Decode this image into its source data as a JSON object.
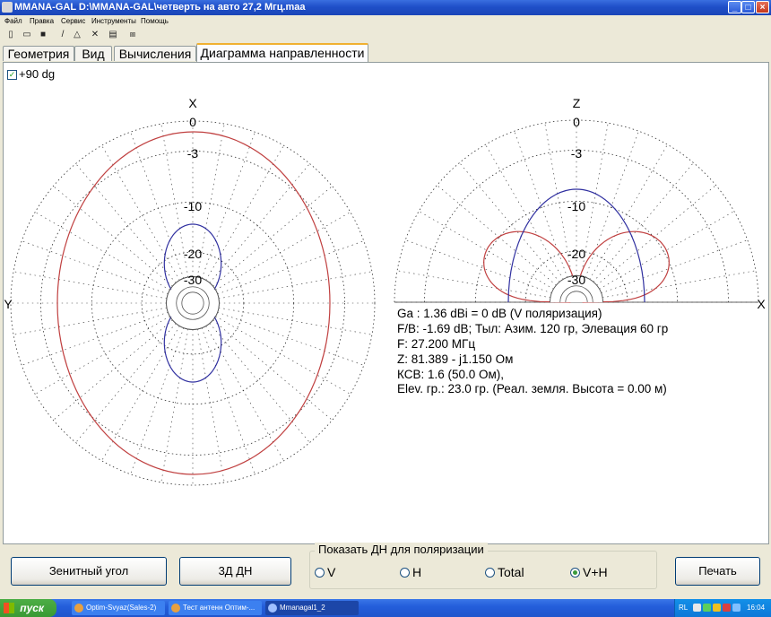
{
  "window": {
    "title": "MMANA-GAL D:\\MMANA-GAL\\четверть на авто 27,2 Мгц.maa"
  },
  "menu": [
    "Файл",
    "Правка",
    "Сервис",
    "Инструменты",
    "Помощь"
  ],
  "toolbar_icons": [
    "new-file-icon",
    "open-folder-icon",
    "save-icon",
    "line-icon",
    "triangle-icon",
    "tools-icon",
    "calculator-icon",
    "antenna-icon"
  ],
  "tabs": [
    "Геометрия",
    "Вид",
    "Вычисления",
    "Диаграмма направленности"
  ],
  "active_tab": "Диаграмма направленности",
  "checkbox": {
    "label": "+90 dg",
    "checked": true
  },
  "plots": {
    "ring_labels": [
      "0",
      "-3",
      "-10",
      "-20",
      "-30"
    ],
    "horizontal": {
      "top_axis": "X",
      "left_axis": "Y"
    },
    "vertical": {
      "top_axis": "Z",
      "right_axis": "X"
    }
  },
  "info": {
    "ga": "Ga : 1.36 dBi = 0 dB  (V поляризация)",
    "fb": "F/B: -1.69 dB; Тыл: Азим. 120 гр, Элевация 60 гр",
    "freq": "F: 27.200 МГц",
    "z": "Z: 81.389 - j1.150 Ом",
    "swr": "КСВ: 1.6 (50.0 Ом),",
    "elev": "Elev. гр.: 23.0 гр. (Реал. земля. Высота = 0.00 м)"
  },
  "buttons": {
    "zenith": "Зенитный угол",
    "three_d": "3Д   ДН",
    "print": "Печать"
  },
  "polarization": {
    "title": "Показать ДН для поляризации",
    "options": [
      "V",
      "H",
      "Total",
      "V+H"
    ],
    "selected": "V+H"
  },
  "taskbar": {
    "start": "пуск",
    "items": [
      "Optim-Svyaz(Sales-2)",
      "Тест антенн Оптим-...",
      "Mmanagal1_2"
    ],
    "lang": "RL",
    "clock": "16:04"
  },
  "colors": {
    "red_pattern": "#c04040",
    "blue_pattern": "#3030a0",
    "grid": "#303030"
  }
}
